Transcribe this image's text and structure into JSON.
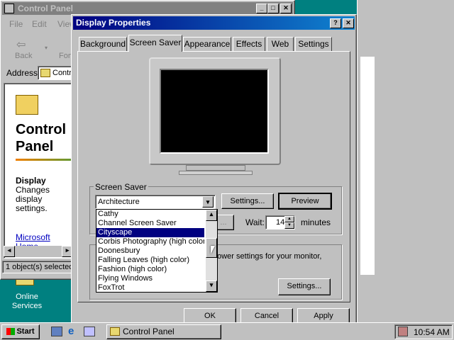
{
  "desktop": {
    "icon_label_1": "Online",
    "icon_label_2": "Services"
  },
  "control_panel": {
    "title": "Control Panel",
    "menu": [
      "File",
      "Edit",
      "View"
    ],
    "toolbar": {
      "back": "Back",
      "forward": "Forw"
    },
    "address_label": "Address",
    "address_value": "Contr",
    "heading_1": "Control",
    "heading_2": "Panel",
    "desc_title": "Display",
    "desc_lines": [
      "Changes",
      "display",
      "settings."
    ],
    "link_1": "Microsoft",
    "link_2": "Home",
    "status": "1 object(s) selected"
  },
  "dialog": {
    "title": "Display Properties",
    "help": "?",
    "close": "✕",
    "tabs": [
      "Background",
      "Screen Saver",
      "Appearance",
      "Effects",
      "Web",
      "Settings"
    ],
    "active_tab": "Screen Saver",
    "group_screensaver": "Screen Saver",
    "selected_saver": "Architecture",
    "settings_btn": "Settings...",
    "preview_btn": "Preview",
    "password_btn": "...",
    "wait_label": "Wait:",
    "wait_value": "14",
    "minutes_label": "minutes",
    "energy_text": "power settings for your monitor,",
    "energy_settings_btn": "Settings...",
    "ok": "OK",
    "cancel": "Cancel",
    "apply": "Apply",
    "dropdown_items": [
      "Cathy",
      "Channel Screen Saver",
      "Cityscape",
      "Corbis Photography (high color)",
      "Doonesbury",
      "Falling Leaves (high color)",
      "Fashion (high color)",
      "Flying Windows",
      "FoxTrot"
    ],
    "highlighted_item": "Cityscape"
  },
  "taskbar": {
    "start": "Start",
    "task": "Control Panel",
    "time": "10:54 AM"
  },
  "colors": {
    "title_active": "#000080",
    "desktop": "#008080",
    "face": "#c0c0c0",
    "highlight": "#000080"
  }
}
